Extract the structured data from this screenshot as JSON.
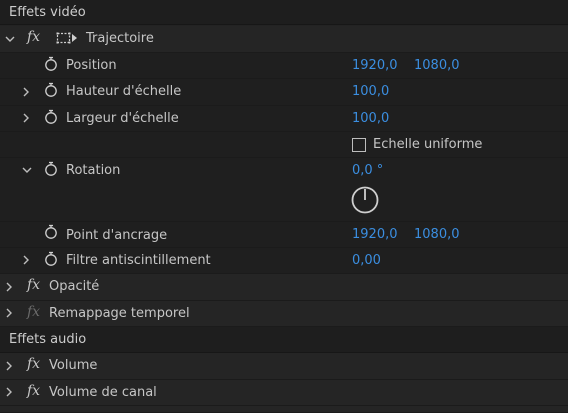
{
  "video_section": {
    "label": "Effets vidéo"
  },
  "motion": {
    "fx_label": "fx",
    "name": "Trajectoire",
    "position": {
      "label": "Position",
      "x": "1920,0",
      "y": "1080,0"
    },
    "scale_height": {
      "label": "Hauteur d'échelle",
      "value": "100,0"
    },
    "scale_width": {
      "label": "Largeur d'échelle",
      "value": "100,0"
    },
    "uniform_scale": {
      "label": "Echelle uniforme",
      "checked": false
    },
    "rotation": {
      "label": "Rotation",
      "value": "0,0 °"
    },
    "anchor_point": {
      "label": "Point d'ancrage",
      "x": "1920,0",
      "y": "1080,0"
    },
    "anti_flicker": {
      "label": "Filtre antiscintillement",
      "value": "0,00"
    }
  },
  "opacity": {
    "fx_label": "fx",
    "name": "Opacité"
  },
  "time_remap": {
    "fx_label": "fx",
    "name": "Remappage temporel"
  },
  "audio_section": {
    "label": "Effets audio"
  },
  "volume": {
    "fx_label": "fx",
    "name": "Volume"
  },
  "channel_volume": {
    "fx_label": "fx",
    "name": "Volume de canal"
  },
  "colors": {
    "background": "#232323",
    "value_blue": "#3b8ee0",
    "text": "#c6c6c6"
  }
}
